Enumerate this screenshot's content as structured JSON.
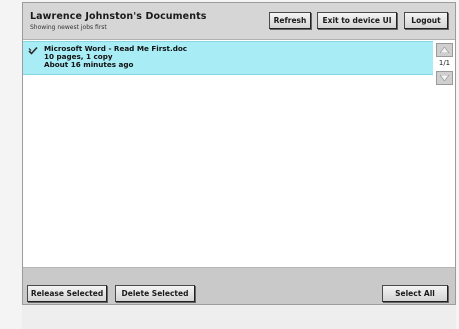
{
  "header": {
    "title": "Lawrence Johnston's Documents",
    "subtitle": "Showing newest jobs first",
    "buttons": {
      "refresh": "Refresh",
      "exit": "Exit to device UI",
      "logout": "Logout"
    }
  },
  "jobs": [
    {
      "selected": true,
      "name": "Microsoft Word - Read Me First.doc",
      "details": "10 pages, 1 copy",
      "age": "About 16 minutes ago"
    }
  ],
  "pagination": {
    "indicator": "1/1"
  },
  "footer": {
    "release_label": "Release Selected",
    "delete_label": "Delete Selected",
    "select_all_label": "Select All"
  },
  "colors": {
    "selected_row": "#a8ecf5",
    "header_bg": "#d6d6d6",
    "footer_bg": "#c9c9c9"
  },
  "icons": {
    "checkmark": "checkmark-icon",
    "scroll_up": "arrow-up-icon",
    "scroll_down": "arrow-down-icon"
  }
}
